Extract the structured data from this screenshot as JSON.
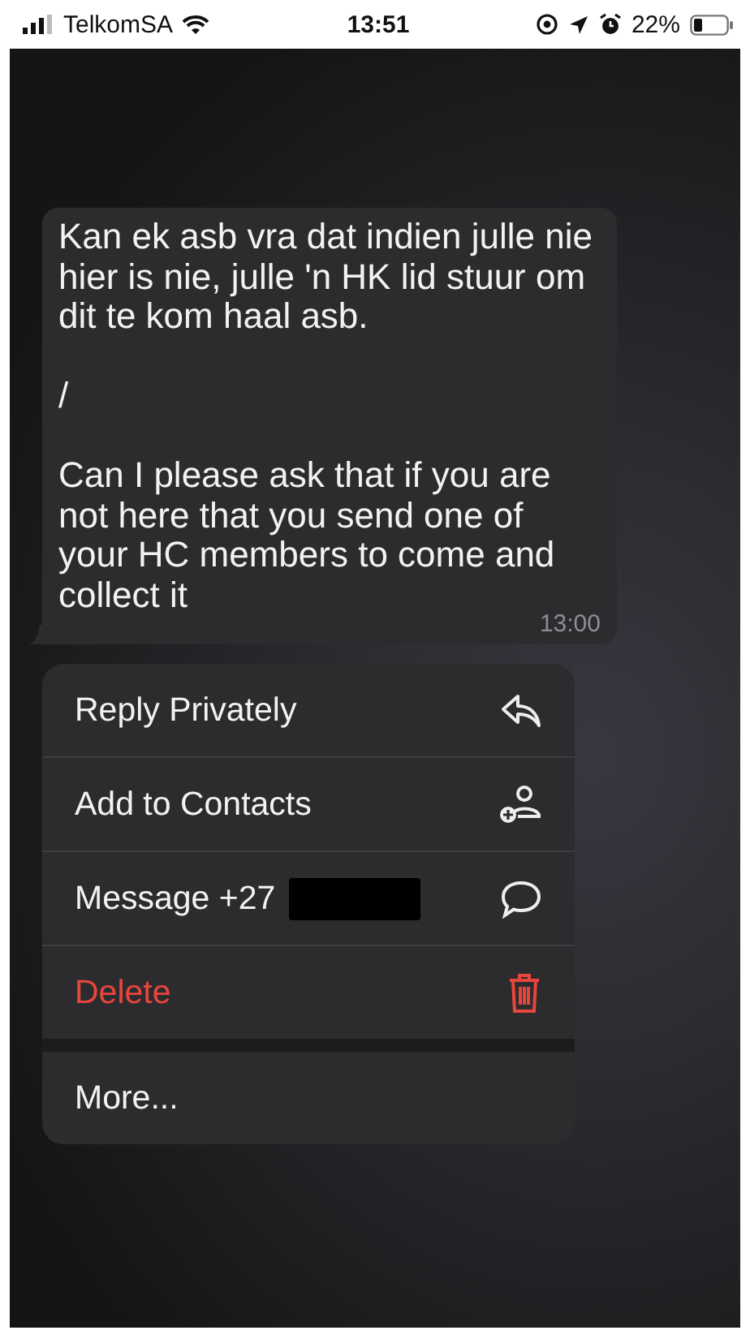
{
  "status_bar": {
    "carrier": "TelkomSA",
    "time": "13:51",
    "battery": "22%"
  },
  "message": {
    "paragraphs": [
      "Kan ek asb vra dat indien julle nie hier is nie, julle 'n HK lid stuur om dit te kom haal asb.",
      "/",
      "Can I please ask that if you are not here that you send one of your HC members to come and collect it"
    ],
    "time": "13:00"
  },
  "menu_groups": [
    [
      {
        "kind": "reply",
        "label": "Reply Privately"
      },
      {
        "kind": "add_contact",
        "label": "Add to Contacts"
      },
      {
        "kind": "message",
        "label": "Message +27",
        "redacted": true
      },
      {
        "kind": "delete",
        "label": "Delete"
      }
    ],
    [
      {
        "kind": "more",
        "label": "More..."
      }
    ]
  ]
}
